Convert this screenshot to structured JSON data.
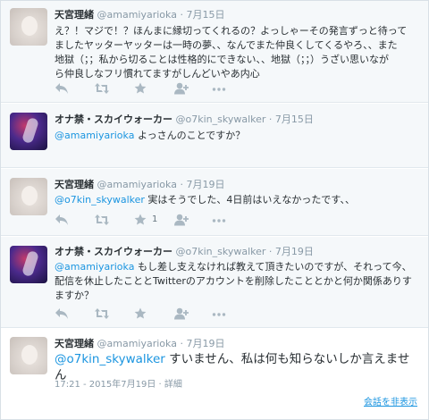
{
  "tweets": [
    {
      "name": "天宮理緒",
      "handle": "@amamiyarioka",
      "sep": "·",
      "date": "7月15日",
      "lines": [
        "え？！マジで！？ほんまに縁切ってくれるの？よっしゃーその発言ずっと待って",
        "ましたヤッターヤッターは一時の夢、、なんでまた仲良くしてくるやろ、、また",
        "地獄（；；私から切ることは性格的にできない、、地獄（；；）うざい思いなが",
        "ら仲良しなフリ慣れてますがしんどいやあ内心"
      ]
    },
    {
      "name": "オナ禁・スカイウォーカー",
      "handle": "@o7kin_skywalker",
      "sep": "·",
      "date": "7月15日",
      "mention": "@amamiyarioka",
      "body": " よっさんのことですか？"
    },
    {
      "name": "天宮理緒",
      "handle": "@amamiyarioka",
      "sep": "·",
      "date": "7月19日",
      "mention": "@o7kin_skywalker",
      "body": " 実はそうでした、4日前はいえなかったです、、",
      "like_count": "1"
    },
    {
      "name": "オナ禁・スカイウォーカー",
      "handle": "@o7kin_skywalker",
      "sep": "·",
      "date": "7月19日",
      "mention": "@amamiyarioka",
      "body": " もし差し支えなければ教えて頂きたいのですが、それって今、",
      "lines": [
        "配信を休止したこととTwitterのアカウントを削除したこととかと何か関係ありす",
        "ますか？"
      ]
    },
    {
      "name": "天宮理緒",
      "handle": "@amamiyarioka",
      "sep": "·",
      "date": "7月19日",
      "mention": "@o7kin_skywalker",
      "body": " すいません、私は何も知らないしか言えません",
      "timestamp": "17:21 - 2015年7月19日",
      "detail": "詳細",
      "hide_link": "会話を非表示"
    }
  ],
  "icons": [
    "reply-icon",
    "retweet-icon",
    "like-icon",
    "follow-icon",
    "more-icon"
  ],
  "colors": {
    "link": "#1b95e0",
    "icon": "#aab8c2",
    "text": "#292f33",
    "muted": "#8899a6"
  }
}
